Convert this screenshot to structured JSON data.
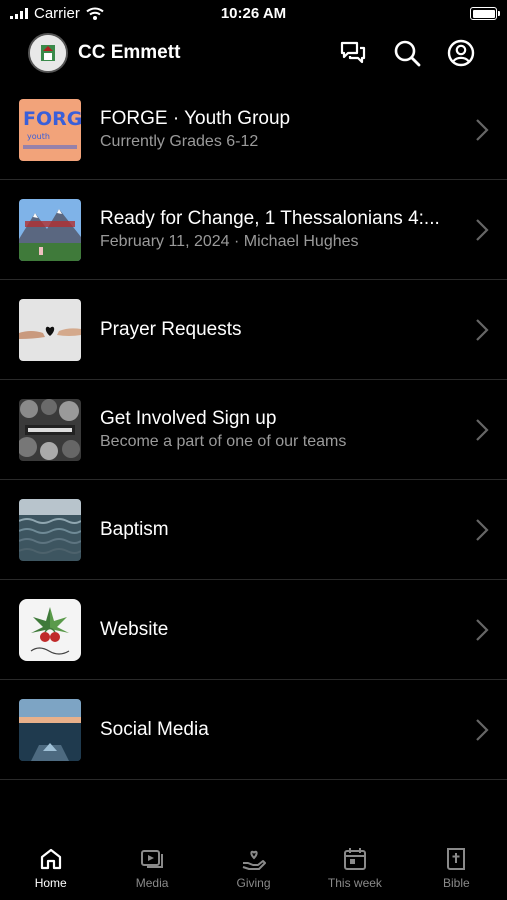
{
  "status_bar": {
    "carrier": "Carrier",
    "time": "10:26 AM"
  },
  "header": {
    "title": "CC Emmett"
  },
  "list": [
    {
      "title": "FORGE · Youth Group",
      "subtitle": "Currently Grades 6-12"
    },
    {
      "title": "Ready for Change, 1 Thessalonians 4:...",
      "subtitle": "February 11, 2024 · Michael Hughes"
    },
    {
      "title": "Prayer Requests",
      "subtitle": ""
    },
    {
      "title": "Get Involved Sign up",
      "subtitle": "Become a part of one of our teams"
    },
    {
      "title": "Baptism",
      "subtitle": ""
    },
    {
      "title": "Website",
      "subtitle": ""
    },
    {
      "title": "Social Media",
      "subtitle": ""
    }
  ],
  "tabs": [
    {
      "label": "Home",
      "icon": "home-icon",
      "active": true
    },
    {
      "label": "Media",
      "icon": "media-icon"
    },
    {
      "label": "Giving",
      "icon": "giving-icon"
    },
    {
      "label": "This week",
      "icon": "calendar-icon"
    },
    {
      "label": "Bible",
      "icon": "bible-icon"
    }
  ],
  "colors": {
    "background": "#000000",
    "text": "#ffffff",
    "secondary_text": "#9a9a9a",
    "inactive_tab": "#8a8a8a",
    "divider": "#2a2a2a"
  }
}
